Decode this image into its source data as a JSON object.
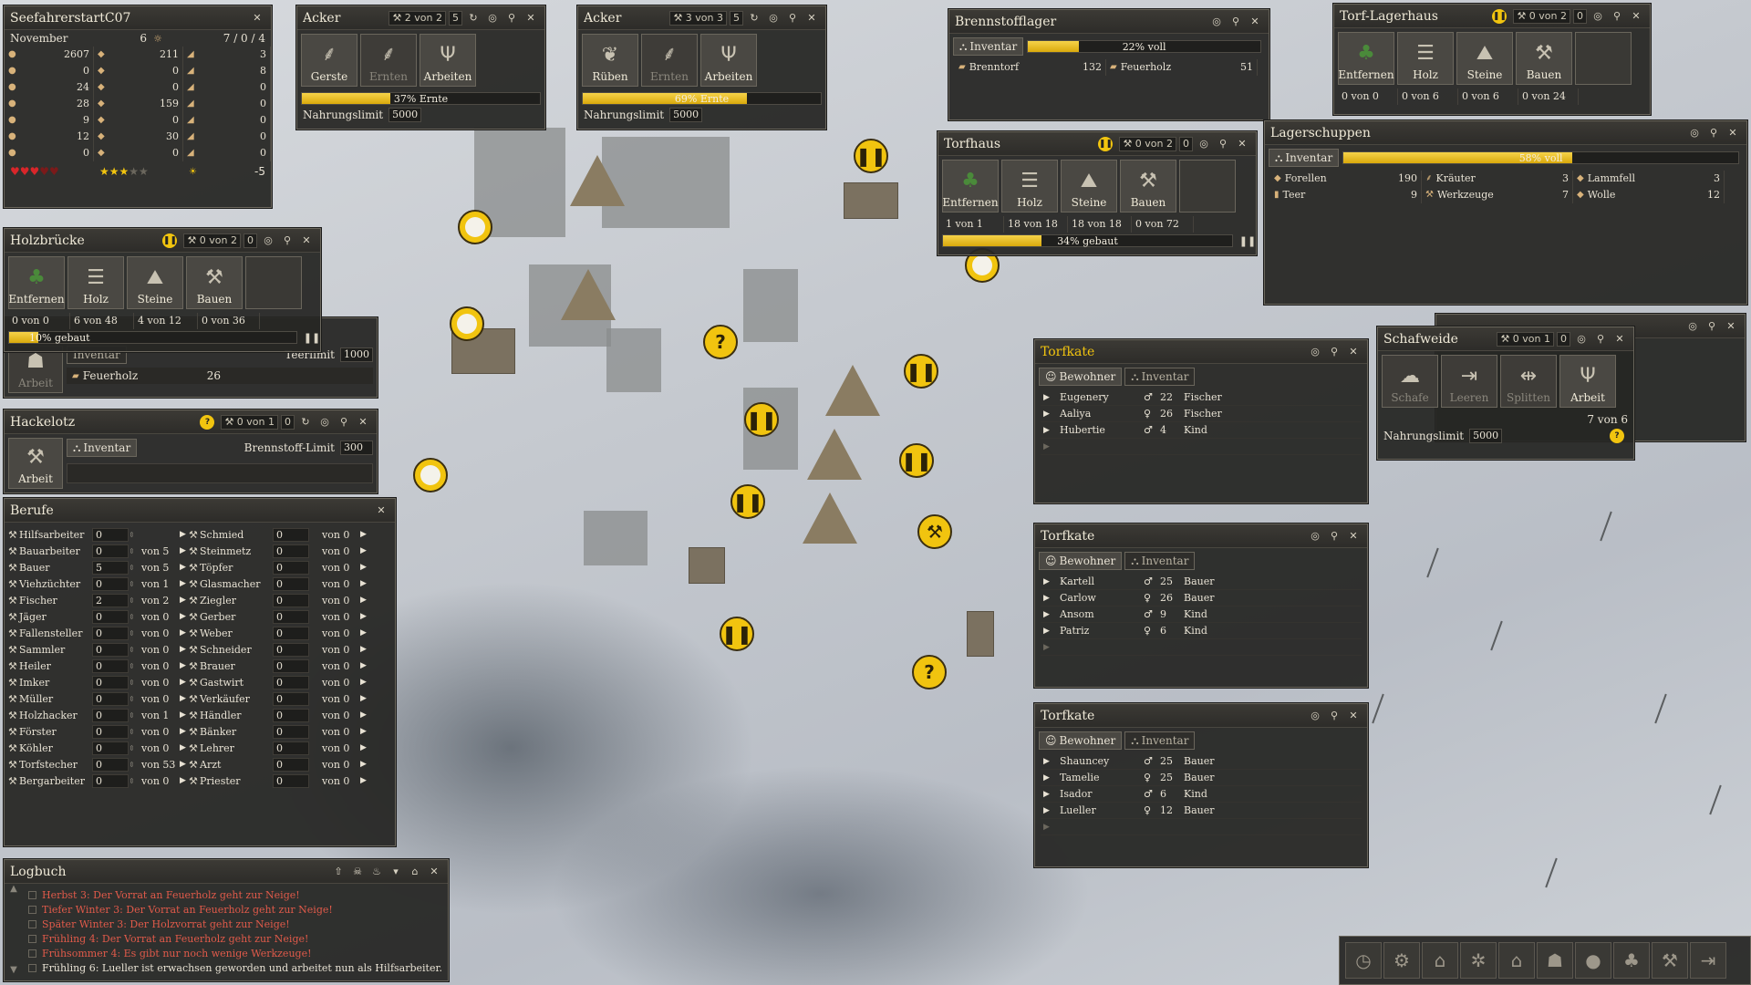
{
  "stats_panel": {
    "title": "SeefahrerstartC07",
    "month": "November",
    "month_num": "6",
    "counter": "7 / 0 / 4",
    "rows": [
      [
        "2607",
        "211",
        "3"
      ],
      [
        "0",
        "0",
        "8"
      ],
      [
        "24",
        "0",
        "0"
      ],
      [
        "28",
        "159",
        "0"
      ],
      [
        "9",
        "0",
        "0"
      ],
      [
        "12",
        "30",
        "0"
      ],
      [
        "0",
        "0",
        "0"
      ]
    ],
    "temp": "-5"
  },
  "acker1": {
    "title": "Acker",
    "spin1": "2 von 2",
    "spin2": "5",
    "buttons": [
      "Gerste",
      "Ernten",
      "Arbeiten"
    ],
    "progress_label": "37% Ernte",
    "progress": 37,
    "limit_label": "Nahrungslimit",
    "limit": "5000"
  },
  "acker2": {
    "title": "Acker",
    "spin1": "3 von 3",
    "spin2": "5",
    "buttons": [
      "Rüben",
      "Ernten",
      "Arbeiten"
    ],
    "progress_label": "69% Ernte",
    "progress": 69,
    "limit_label": "Nahrungslimit",
    "limit": "5000"
  },
  "brennstofflager": {
    "title": "Brennstofflager",
    "tab": "Inventar",
    "fill_label": "22% voll",
    "fill": 22,
    "items": [
      [
        "Brenntorf",
        "132"
      ],
      [
        "Feuerholz",
        "51"
      ]
    ]
  },
  "torflager": {
    "title": "Torf-Lagerhaus",
    "spin1": "0 von 2",
    "spin2": "0",
    "buttons": [
      "Entfernen",
      "Holz",
      "Steine",
      "Bauen"
    ],
    "values": [
      "0 von 0",
      "0 von 6",
      "0 von 6",
      "0 von 24"
    ]
  },
  "torfhaus": {
    "title": "Torfhaus",
    "spin1": "0 von 2",
    "spin2": "0",
    "buttons": [
      "Entfernen",
      "Holz",
      "Steine",
      "Bauen"
    ],
    "values": [
      "1 von 1",
      "18 von 18",
      "18 von 18",
      "0 von 72"
    ],
    "progress_label": "34% gebaut",
    "progress": 34
  },
  "lagerschuppen": {
    "title": "Lagerschuppen",
    "tab": "Inventar",
    "fill_label": "58% voll",
    "fill": 58,
    "items": [
      [
        "Forellen",
        "190",
        "Kräuter",
        "3",
        "Lammfell",
        "3"
      ],
      [
        "Teer",
        "9",
        "Werkzeuge",
        "7",
        "Wolle",
        "12"
      ]
    ]
  },
  "holzbruecke": {
    "title": "Holzbrücke",
    "spin1": "0 von 2",
    "spin2": "0",
    "buttons": [
      "Entfernen",
      "Holz",
      "Steine",
      "Bauen"
    ],
    "values": [
      "0 von 0",
      "6 von 48",
      "4 von 12",
      "0 von 36"
    ],
    "progress_label": "10% gebaut",
    "progress": 10
  },
  "hidden_panel": {
    "tab": "Inventar",
    "limit_label": "Teerlimit",
    "limit": "1000",
    "button": "Arbeit",
    "item": "Feuerholz",
    "item_val": "26"
  },
  "hackelotz": {
    "title": "Hackelotz",
    "spin1": "0 von 1",
    "spin2": "0",
    "button": "Arbeit",
    "tab": "Inventar",
    "limit_label": "Brennstoff-Limit",
    "limit": "300"
  },
  "berufe": {
    "title": "Berufe",
    "rows": [
      {
        "l": "Hilfsarbeiter",
        "lv": "0",
        "lmax": "",
        "r": "Schmied",
        "rv": "0",
        "rmax": "von 0"
      },
      {
        "l": "Bauarbeiter",
        "lv": "0",
        "lmax": "von 5",
        "r": "Steinmetz",
        "rv": "0",
        "rmax": "von 0"
      },
      {
        "l": "Bauer",
        "lv": "5",
        "lmax": "von 5",
        "r": "Töpfer",
        "rv": "0",
        "rmax": "von 0"
      },
      {
        "l": "Viehzüchter",
        "lv": "0",
        "lmax": "von 1",
        "r": "Glasmacher",
        "rv": "0",
        "rmax": "von 0"
      },
      {
        "l": "Fischer",
        "lv": "2",
        "lmax": "von 2",
        "r": "Ziegler",
        "rv": "0",
        "rmax": "von 0"
      },
      {
        "l": "Jäger",
        "lv": "0",
        "lmax": "von 0",
        "r": "Gerber",
        "rv": "0",
        "rmax": "von 0"
      },
      {
        "l": "Fallensteller",
        "lv": "0",
        "lmax": "von 0",
        "r": "Weber",
        "rv": "0",
        "rmax": "von 0"
      },
      {
        "l": "Sammler",
        "lv": "0",
        "lmax": "von 0",
        "r": "Schneider",
        "rv": "0",
        "rmax": "von 0"
      },
      {
        "l": "Heiler",
        "lv": "0",
        "lmax": "von 0",
        "r": "Brauer",
        "rv": "0",
        "rmax": "von 0"
      },
      {
        "l": "Imker",
        "lv": "0",
        "lmax": "von 0",
        "r": "Gastwirt",
        "rv": "0",
        "rmax": "von 0"
      },
      {
        "l": "Müller",
        "lv": "0",
        "lmax": "von 0",
        "r": "Verkäufer",
        "rv": "0",
        "rmax": "von 0"
      },
      {
        "l": "Holzhacker",
        "lv": "0",
        "lmax": "von 1",
        "r": "Händler",
        "rv": "0",
        "rmax": "von 0"
      },
      {
        "l": "Förster",
        "lv": "0",
        "lmax": "von 0",
        "r": "Bänker",
        "rv": "0",
        "rmax": "von 0"
      },
      {
        "l": "Köhler",
        "lv": "0",
        "lmax": "von 0",
        "r": "Lehrer",
        "rv": "0",
        "rmax": "von 0"
      },
      {
        "l": "Torfstecher",
        "lv": "0",
        "lmax": "von 53",
        "r": "Arzt",
        "rv": "0",
        "rmax": "von 0"
      },
      {
        "l": "Bergarbeiter",
        "lv": "0",
        "lmax": "von 0",
        "r": "Priester",
        "rv": "0",
        "rmax": "von 0"
      }
    ]
  },
  "logbuch": {
    "title": "Logbuch",
    "lines": [
      {
        "text": "Herbst 3: Der Vorrat an Feuerholz geht zur Neige!",
        "warn": true
      },
      {
        "text": "Tiefer Winter 3: Der Vorrat an Feuerholz geht zur Neige!",
        "warn": true
      },
      {
        "text": "Später Winter 3: Der Holzvorrat geht zur Neige!",
        "warn": true
      },
      {
        "text": "Frühling 4: Der Vorrat an Feuerholz geht zur Neige!",
        "warn": true
      },
      {
        "text": "Frühsommer 4: Es gibt nur noch wenige Werkzeuge!",
        "warn": true
      },
      {
        "text": "Frühling 6: Lueller ist erwachsen geworden und arbeitet nun als Hilfsarbeiter.",
        "warn": false
      }
    ]
  },
  "torfkate1": {
    "title": "Torfkate",
    "tabs": [
      "Bewohner",
      "Inventar"
    ],
    "rows": [
      [
        "Eugenery",
        "♂",
        "22",
        "Fischer"
      ],
      [
        "Aaliya",
        "♀",
        "26",
        "Fischer"
      ],
      [
        "Hubertie",
        "♂",
        "4",
        "Kind"
      ]
    ]
  },
  "torfkate2": {
    "title": "Torfkate",
    "tabs": [
      "Bewohner",
      "Inventar"
    ],
    "rows": [
      [
        "Kartell",
        "♂",
        "25",
        "Bauer"
      ],
      [
        "Carlow",
        "♀",
        "26",
        "Bauer"
      ],
      [
        "Ansom",
        "♂",
        "9",
        "Kind"
      ],
      [
        "Patriz",
        "♀",
        "6",
        "Kind"
      ]
    ]
  },
  "torfkate3": {
    "title": "Torfkate",
    "tabs": [
      "Bewohner",
      "Inventar"
    ],
    "rows": [
      [
        "Shauncey",
        "♂",
        "25",
        "Bauer"
      ],
      [
        "Tamelie",
        "♀",
        "25",
        "Bauer"
      ],
      [
        "Isador",
        "♂",
        "6",
        "Kind"
      ],
      [
        "Lueller",
        "♀",
        "12",
        "Bauer"
      ]
    ]
  },
  "schafweide": {
    "title": "Schafweide",
    "spin1": "0 von 1",
    "spin2": "0",
    "buttons": [
      "Schafe",
      "Leeren",
      "Splitten",
      "Arbeit"
    ],
    "count": "7 von 6",
    "limit_label": "Nahrungslimit",
    "limit": "5000"
  },
  "colors": {
    "accent": "#f1c40f",
    "warn": "#e05a4a"
  }
}
